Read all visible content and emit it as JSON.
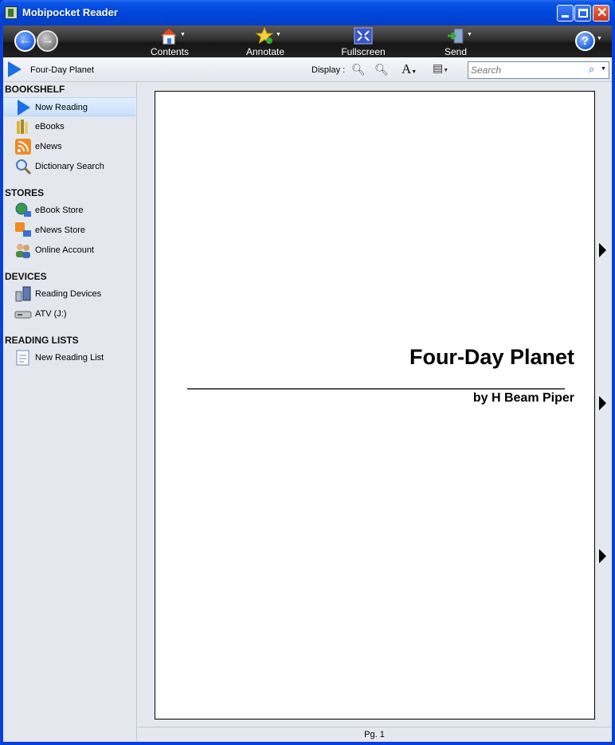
{
  "window": {
    "title": "Mobipocket Reader"
  },
  "toolbar": {
    "back_icon": "back-arrow-icon",
    "forward_icon": "forward-arrow-icon",
    "items": [
      {
        "label": "Contents",
        "icon": "home-icon"
      },
      {
        "label": "Annotate",
        "icon": "star-icon"
      },
      {
        "label": "Fullscreen",
        "icon": "fullscreen-icon"
      },
      {
        "label": "Send",
        "icon": "send-device-icon"
      }
    ],
    "help": "?"
  },
  "infobar": {
    "book_title": "Four-Day Planet",
    "display_label": "Display :",
    "search_placeholder": "Search"
  },
  "sidebar": {
    "sections": [
      {
        "title": "BOOKSHELF",
        "items": [
          "Now Reading",
          "eBooks",
          "eNews",
          "Dictionary Search"
        ]
      },
      {
        "title": "STORES",
        "items": [
          "eBook Store",
          "eNews Store",
          "Online Account"
        ]
      },
      {
        "title": "DEVICES",
        "items": [
          "Reading Devices",
          "ATV (J:)"
        ]
      },
      {
        "title": "READING LISTS",
        "items": [
          "New Reading List"
        ]
      }
    ]
  },
  "page": {
    "heading": "Four-Day Planet",
    "byline": "by H Beam Piper"
  },
  "status": {
    "page": "Pg. 1"
  },
  "colors": {
    "titlebar": "#0046dc",
    "toolbar": "#222222",
    "accent": "#1a6ee8"
  }
}
